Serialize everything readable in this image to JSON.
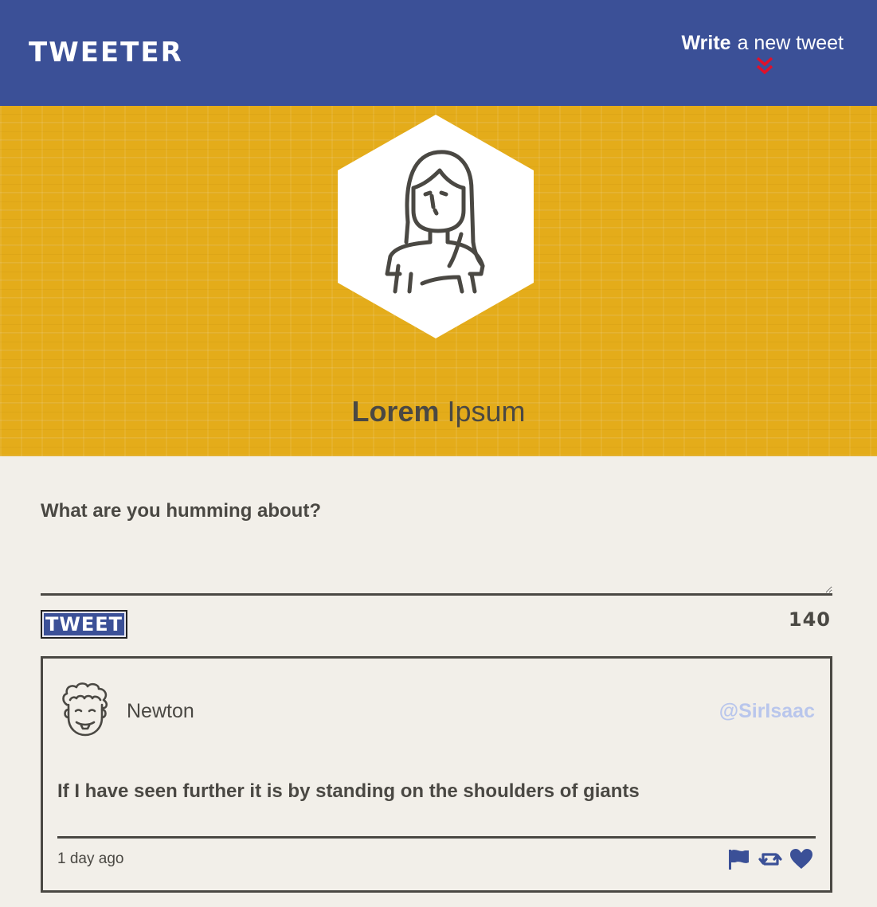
{
  "nav": {
    "brand": "TWEETER",
    "write_strong": "Write",
    "write_light": "a new tweet"
  },
  "profile": {
    "first_name": "Lorem",
    "last_name": "Ipsum"
  },
  "compose": {
    "label": "What are you humming about?",
    "value": "",
    "button_label": "TWEET",
    "counter": "140"
  },
  "tweet": {
    "author": "Newton",
    "handle": "@SirIsaac",
    "text": "If I have seen further it is by standing on the shoulders of giants",
    "time": "1 day ago",
    "icons": [
      "flag-icon",
      "retweet-icon",
      "heart-icon"
    ]
  },
  "colors": {
    "nav": "#3b5097",
    "banner": "#e4ac1a",
    "background": "#f2efe9",
    "text": "#4a4843",
    "chevron": "#e0102a",
    "handle": "#b9c6ec",
    "icon": "#3b5097"
  }
}
